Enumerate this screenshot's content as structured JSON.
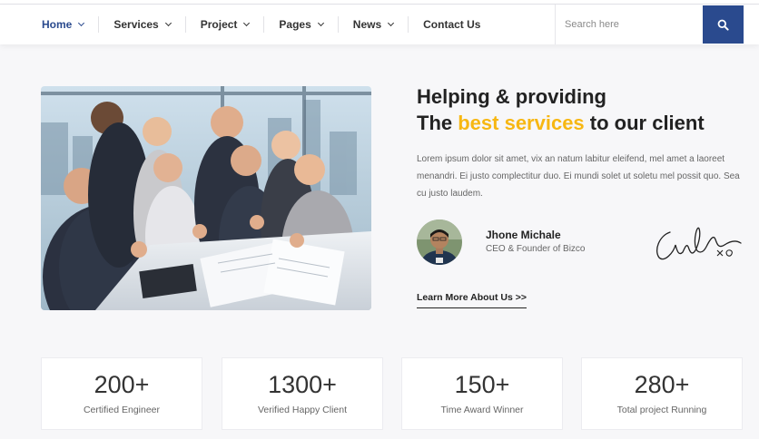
{
  "nav": {
    "items": [
      {
        "label": "Home",
        "dropdown": true,
        "active": true
      },
      {
        "label": "Services",
        "dropdown": true
      },
      {
        "label": "Project",
        "dropdown": true
      },
      {
        "label": "Pages",
        "dropdown": true
      },
      {
        "label": "News",
        "dropdown": true
      },
      {
        "label": "Contact Us",
        "dropdown": false
      }
    ]
  },
  "search": {
    "placeholder": "Search here",
    "button_icon": "search-icon"
  },
  "hero": {
    "image_icon": "team-photo",
    "headline_line1": "Helping & providing",
    "headline_pre": "The ",
    "headline_accent": "best services",
    "headline_post": " to our client",
    "paragraph": "Lorem ipsum dolor sit amet, vix an natum labitur eleifend, mel amet a laoreet menandri. Ei justo complectitur duo. Ei mundi solet ut soletu mel possit quo. Sea cu justo laudem.",
    "author": {
      "name": "Jhone Michale",
      "role": "CEO & Founder of Bizco"
    },
    "learn_more": "Learn More About Us >>"
  },
  "stats": [
    {
      "value": "200+",
      "label": "Certified Engineer"
    },
    {
      "value": "1300+",
      "label": "Verified Happy Client"
    },
    {
      "value": "150+",
      "label": "Time Award Winner"
    },
    {
      "value": "280+",
      "label": "Total project Running"
    }
  ],
  "colors": {
    "primary": "#2a4a8e",
    "accent": "#f7b712",
    "text": "#222222",
    "muted": "#666666",
    "background": "#f7f7f9"
  }
}
